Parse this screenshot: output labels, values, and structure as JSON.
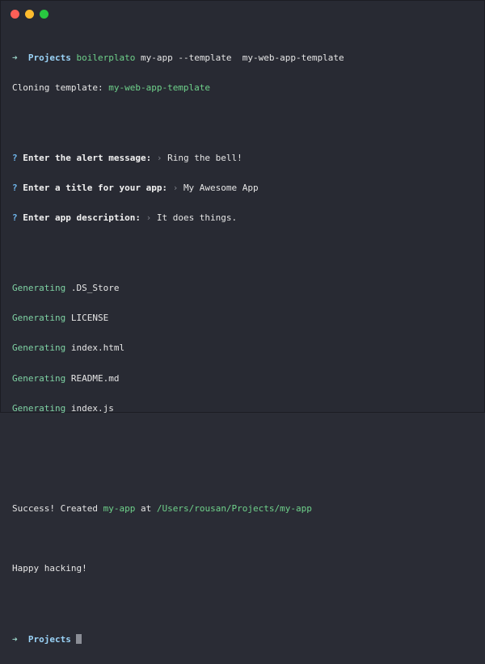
{
  "window": {
    "controls": [
      "close",
      "minimize",
      "zoom"
    ]
  },
  "terminal": {
    "command": {
      "arrow": "➜",
      "dir": "Projects",
      "program": "boilerplato",
      "args": " my-app --template  my-web-app-template"
    },
    "cloning": {
      "label": "Cloning template: ",
      "value": "my-web-app-template"
    },
    "prompts": [
      {
        "mark": "?",
        "label": "Enter the alert message:",
        "chev": "›",
        "answer": "Ring the bell!"
      },
      {
        "mark": "?",
        "label": "Enter a title for your app:",
        "chev": "›",
        "answer": "My Awesome App"
      },
      {
        "mark": "?",
        "label": "Enter app description:",
        "chev": "›",
        "answer": "It does things."
      }
    ],
    "generating": {
      "word": "Generating",
      "files": [
        ".DS_Store",
        "LICENSE",
        "index.html",
        "README.md",
        "index.js"
      ]
    },
    "success": {
      "prefix": "Success! Created ",
      "app": "my-app",
      "middle": " at ",
      "path": "/Users/rousan/Projects/my-app"
    },
    "happy": "Happy hacking!",
    "final_prompt": {
      "arrow": "➜",
      "dir": "Projects"
    }
  },
  "colors": {
    "background": "#282a33",
    "green": "#6fd28b",
    "cyan": "#9ad3f7",
    "question": "#6fb6ec"
  }
}
